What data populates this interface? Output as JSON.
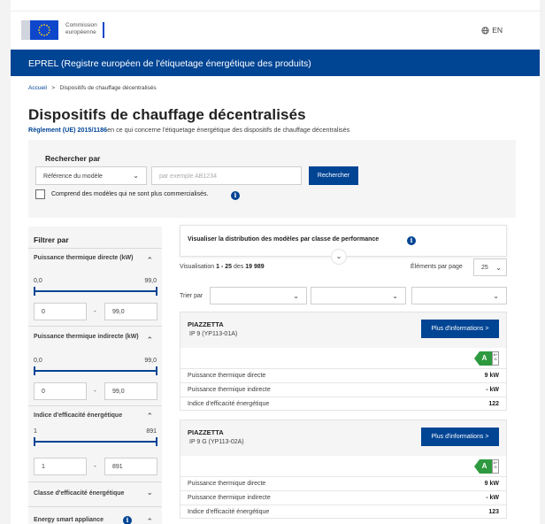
{
  "header": {
    "logo_line1": "Commission",
    "logo_line2": "européenne",
    "language": "EN",
    "language_icon": "globe-icon"
  },
  "banner": {
    "title": "EPREL (Registre européen de l'étiquetage énergétique des produits)"
  },
  "breadcrumb": {
    "home": "Accueil",
    "separator": ">",
    "current": "Dispositifs de chauffage décentralisés"
  },
  "page": {
    "title": "Dispositifs de chauffage décentralisés",
    "regulation": "Règlement (UE) 2015/1186",
    "subtitle_rest": "en ce qui concerne l'étiquetage énergétique des dispositifs de chauffage décentralisés"
  },
  "search": {
    "label": "Rechercher par",
    "field_select": "Référence du modèle",
    "input_placeholder": "par exemple AB1234",
    "button": "Rechercher",
    "checkbox_label": "Comprend des modèles qui ne sont plus commercialisés."
  },
  "filters": {
    "title": "Filtrer par",
    "groups": [
      {
        "title": "Puissance thermique directe (kW)",
        "min_label": "0,0",
        "max_label": "99,0",
        "min_value": "0",
        "max_value": "99,0"
      },
      {
        "title": "Puissance thermique indirecte (kW)",
        "min_label": "0,0",
        "max_label": "99,0",
        "min_value": "0",
        "max_value": "99,0"
      },
      {
        "title": "Indice d'efficacité énergétique",
        "min_label": "1",
        "max_label": "891",
        "min_value": "1",
        "max_value": "891"
      }
    ],
    "collapsed": [
      {
        "title": "Classe d'efficacité énergétique"
      },
      {
        "title": "Energy smart appliance"
      }
    ],
    "range_dash": "-"
  },
  "results": {
    "visualize_label": "Visualiser la distribution des modèles par classe de performance",
    "showing_prefix": "Visualisation",
    "showing_range": "1 - 25",
    "showing_of": "des",
    "total": "19 989",
    "per_page_label": "Éléments par page",
    "per_page_value": "25",
    "sort_label": "Trier par",
    "energy_scale_top": "A+",
    "energy_scale_bottom": "G",
    "items": [
      {
        "brand": "PIAZZETTA",
        "model": "IP 9 (YP113-01A)",
        "button": "Plus d'informations >",
        "energy_class": "A",
        "rows": [
          {
            "label": "Puissance thermique directe",
            "value": "9 kW"
          },
          {
            "label": "Puissance thermique indirecte",
            "value": "- kW"
          },
          {
            "label": "Indice d'efficacité énergétique",
            "value": "122"
          }
        ]
      },
      {
        "brand": "PIAZZETTA",
        "model": "IP 9 G (YP113-02A)",
        "button": "Plus d'informations >",
        "energy_class": "A",
        "rows": [
          {
            "label": "Puissance thermique directe",
            "value": "9 kW"
          },
          {
            "label": "Puissance thermique indirecte",
            "value": "- kW"
          },
          {
            "label": "Indice d'efficacité énergétique",
            "value": "123"
          }
        ]
      }
    ]
  },
  "colors": {
    "brand_blue": "#004494",
    "energy_green": "#2e9a3f",
    "panel_grey": "#f5f5f5"
  }
}
